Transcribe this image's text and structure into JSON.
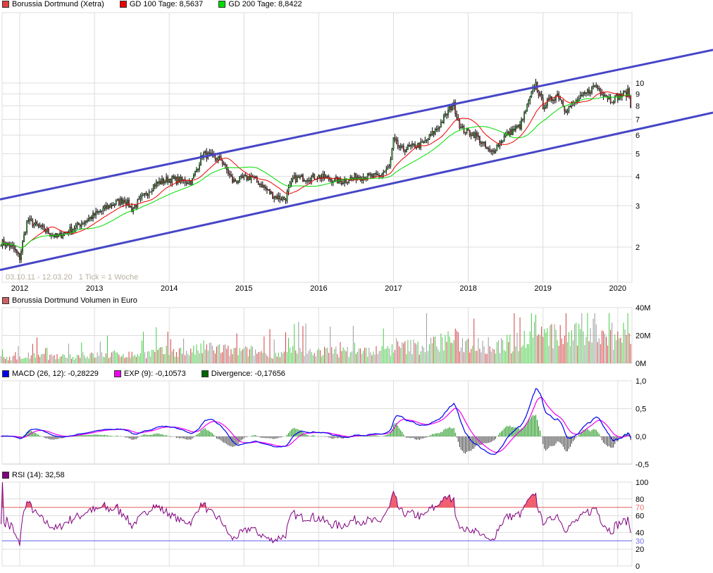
{
  "legend_price": [
    {
      "label": "Borussia Dortmund (Xetra)",
      "color": "#e04040"
    },
    {
      "label": "GD 100 Tage: 8,5637",
      "color": "#ee0000"
    },
    {
      "label": "GD 200 Tage: 8,8422",
      "color": "#00dd00"
    }
  ],
  "legend_volume": [
    {
      "label": "Borussia Dortmund Volumen in Euro",
      "color": "#d06060"
    }
  ],
  "legend_macd": [
    {
      "label": "MACD (26, 12): -0,28229",
      "color": "#0000ee"
    },
    {
      "label": "EXP (9): -0,10573",
      "color": "#ee00ee"
    },
    {
      "label": "Divergence: -0,17656",
      "color": "#006600"
    }
  ],
  "legend_rsi": [
    {
      "label": "RSI (14): 32,58",
      "color": "#800080"
    }
  ],
  "range_note": "03.10.11 - 12.03.20   1 Tick = 1 Woche",
  "chart_data": {
    "type": "line",
    "x_ticks": [
      "2012",
      "2013",
      "2014",
      "2015",
      "2016",
      "2017",
      "2018",
      "2019",
      "2020"
    ],
    "price": {
      "scale": "log",
      "y_ticks": [
        "2",
        "3",
        "4",
        "5",
        "6",
        "7",
        "8",
        "9",
        "10"
      ],
      "keypoints": [
        [
          2011.75,
          2.1
        ],
        [
          2011.9,
          2.0
        ],
        [
          2012.0,
          1.8
        ],
        [
          2012.1,
          2.6
        ],
        [
          2012.4,
          2.3
        ],
        [
          2012.5,
          2.2
        ],
        [
          2012.8,
          2.5
        ],
        [
          2013.2,
          3.0
        ],
        [
          2013.4,
          3.2
        ],
        [
          2013.5,
          2.9
        ],
        [
          2013.8,
          3.7
        ],
        [
          2014.0,
          3.9
        ],
        [
          2014.3,
          3.8
        ],
        [
          2014.45,
          5.0
        ],
        [
          2014.7,
          4.7
        ],
        [
          2014.85,
          3.8
        ],
        [
          2015.1,
          4.0
        ],
        [
          2015.4,
          3.3
        ],
        [
          2015.55,
          3.2
        ],
        [
          2015.65,
          3.9
        ],
        [
          2016.0,
          4.0
        ],
        [
          2016.3,
          3.8
        ],
        [
          2016.5,
          4.0
        ],
        [
          2016.8,
          4.0
        ],
        [
          2016.95,
          4.4
        ],
        [
          2017.0,
          5.7
        ],
        [
          2017.1,
          5.2
        ],
        [
          2017.4,
          5.5
        ],
        [
          2017.6,
          6.5
        ],
        [
          2017.8,
          8.2
        ],
        [
          2017.9,
          6.4
        ],
        [
          2018.1,
          6.0
        ],
        [
          2018.3,
          5.0
        ],
        [
          2018.5,
          6.0
        ],
        [
          2018.7,
          6.6
        ],
        [
          2018.9,
          10.0
        ],
        [
          2019.0,
          8.0
        ],
        [
          2019.2,
          9.0
        ],
        [
          2019.3,
          7.7
        ],
        [
          2019.5,
          8.6
        ],
        [
          2019.7,
          9.8
        ],
        [
          2019.9,
          8.5
        ],
        [
          2020.1,
          9.0
        ],
        [
          2020.15,
          9.2
        ],
        [
          2020.19,
          6.9
        ]
      ],
      "channel_upper": [
        [
          2011.75,
          3.2
        ],
        [
          2020.5,
          12.3
        ]
      ],
      "channel_lower": [
        [
          2011.75,
          1.6
        ],
        [
          2020.5,
          6.6
        ]
      ]
    },
    "volume": {
      "y_ticks": [
        "0M",
        "20M",
        "40M"
      ],
      "ylim": [
        0,
        40
      ]
    },
    "macd": {
      "y_ticks": [
        "-0,5",
        "0,0",
        "0,5",
        "1,0"
      ],
      "ylim": [
        -0.5,
        1.0
      ]
    },
    "rsi": {
      "y_ticks": [
        "0",
        "20",
        "30",
        "40",
        "60",
        "70",
        "80",
        "100"
      ],
      "ylim": [
        0,
        100
      ],
      "levels": [
        30,
        70
      ]
    }
  },
  "colors": {
    "channel": "#4646c8",
    "up": "#33cc33",
    "down": "#e04040",
    "grid": "#dddddd"
  }
}
